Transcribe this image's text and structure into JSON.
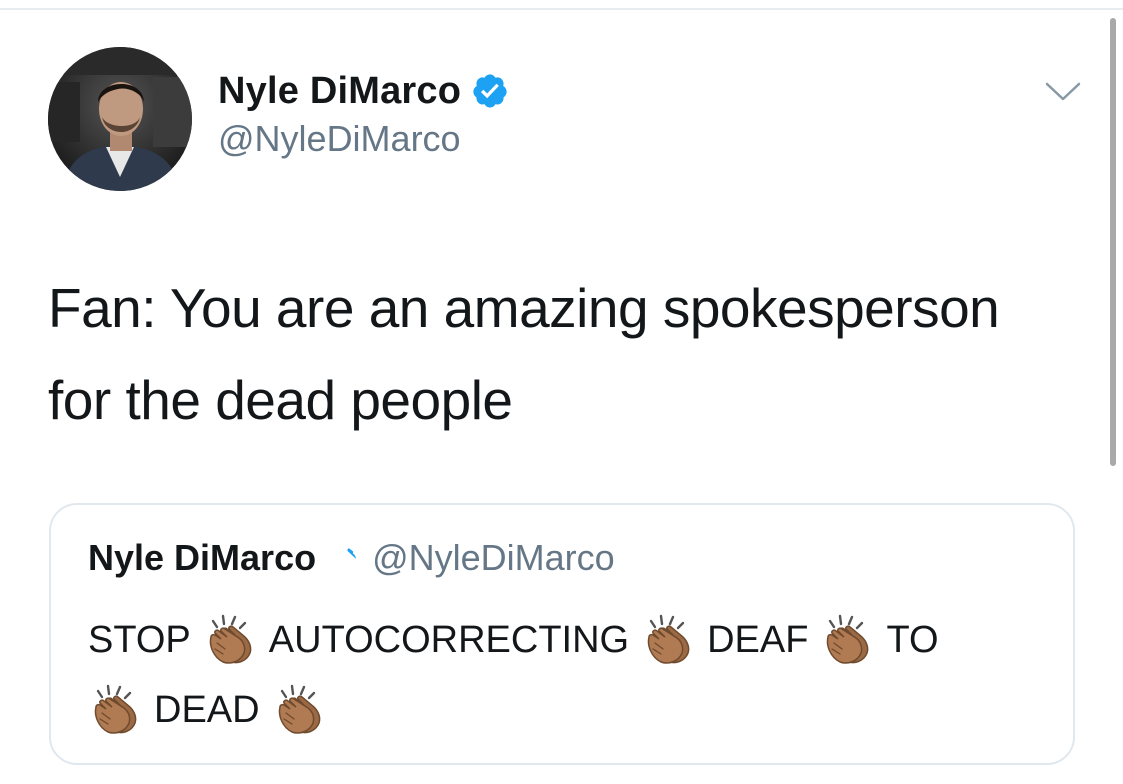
{
  "tweet": {
    "author": {
      "display_name": "Nyle DiMarco",
      "handle": "@NyleDiMarco",
      "verified": true,
      "avatar_icon": "user-avatar-photo"
    },
    "menu_icon": "chevron-down-icon",
    "text_lines": [
      "Fan: You are an amazing spokesperson",
      "for the dead people"
    ],
    "quoted_tweet": {
      "display_name": "Nyle DiMarco",
      "handle": "@NyleDiMarco",
      "verified": true,
      "words": [
        "STOP",
        "AUTOCORRECTING",
        "DEAF",
        "TO",
        "DEAD"
      ],
      "emoji": "clapping-hands-icon"
    }
  },
  "colors": {
    "text_primary": "#14171a",
    "text_secondary": "#657786",
    "verified_blue": "#1da1f2",
    "card_border": "#e1e8ed",
    "clap_skin": "#b07a52"
  }
}
